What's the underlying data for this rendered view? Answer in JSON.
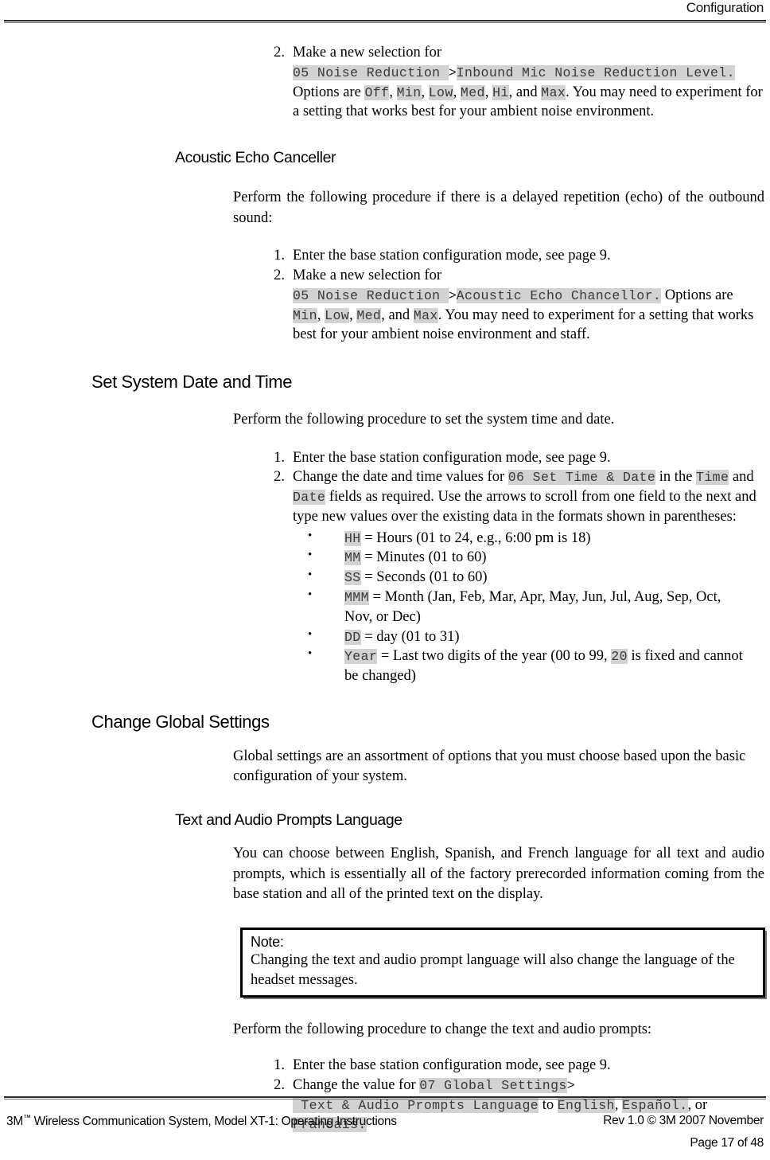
{
  "header": {
    "title": "Configuration"
  },
  "footer": {
    "left_prefix": "3M",
    "left_tm": "™",
    "left_rest": " Wireless Communication System, Model XT-1: Operating Instructions",
    "right": "Rev 1.0 © 3M 2007 November",
    "page": "Page 17 of 48"
  },
  "noise_reduction_step": {
    "num": "2.",
    "t1": "Make a new selection for ",
    "kw1": "05 Noise Reduction ",
    "gt1": ">",
    "kw2": "Inbound Mic Noise Reduction Level.",
    "t2": " Options are ",
    "opt1": "Off",
    "c1": ", ",
    "opt2": "Min",
    "c2": ", ",
    "opt3": "Low",
    "c3": ", ",
    "opt4": "Med",
    "c4": ", ",
    "opt5": "Hi",
    "t3": ", and ",
    "opt6": "Max",
    "t4": ".  You may need to experiment for a setting that works best for your ambient noise environment."
  },
  "acoustic_echo": {
    "heading": "Acoustic Echo Canceller",
    "intro": "Perform the following procedure if there is a delayed repetition (echo) of the outbound sound:",
    "step1_num": "1.",
    "step1": "Enter the base station configuration mode, see page 9.",
    "step2_num": "2.",
    "step2_t1": "Make a new selection for ",
    "step2_kw1": "05 Noise Reduction ",
    "step2_gt": ">",
    "step2_kw2": "Acoustic Echo Chancellor.",
    "step2_t2": "  Options are ",
    "step2_opt1": "Min",
    "step2_c1": ", ",
    "step2_opt2": "Low",
    "step2_c2": ", ",
    "step2_opt3": "Med",
    "step2_t3": ", and ",
    "step2_opt4": "Max",
    "step2_t4": ".  You may need to experiment for a setting that works best for your ambient noise environment and staff."
  },
  "set_date_time": {
    "heading": "Set System Date and Time",
    "intro": "Perform the following procedure to set the system time and date.",
    "step1_num": "1.",
    "step1": "Enter the base station configuration mode, see page 9.",
    "step2_num": "2.",
    "step2_t1": "Change the date and time values for  ",
    "step2_kw1": "06 Set Time & Date",
    "step2_t2": " in the ",
    "step2_kw2": "Time",
    "step2_t3": " and ",
    "step2_kw3": "Date",
    "step2_t4": " fields as required.  Use the arrows to scroll from one field to the next and type new values over the existing data in the formats shown in parentheses:",
    "formats": [
      {
        "bullet": "•",
        "code": "HH",
        "desc": " = Hours (01 to 24, e.g., 6:00 pm is 18)"
      },
      {
        "bullet": "•",
        "code": "MM",
        "desc": " = Minutes (01 to 60)"
      },
      {
        "bullet": "•",
        "code": "SS",
        "desc": " = Seconds (01 to 60)"
      },
      {
        "bullet": "•",
        "code": "MMM",
        "desc": " = Month (Jan, Feb, Mar, Apr, May, Jun, Jul, Aug, Sep, Oct, Nov, or Dec)"
      },
      {
        "bullet": "•",
        "code": "DD",
        "desc": " = day (01 to 31)"
      }
    ],
    "year_bullet": "•",
    "year_code": "Year",
    "year_t1": " = Last two digits of the year (00 to 99, ",
    "year_code2": "20",
    "year_t2": " is fixed and cannot be changed)"
  },
  "global_settings": {
    "heading": "Change Global Settings",
    "intro": "Global settings are an assortment of options that you must choose based upon the basic configuration of your system."
  },
  "text_audio": {
    "heading": "Text and Audio Prompts Language",
    "intro": "You can choose between English, Spanish, and French language for all text and audio prompts, which is essentially all of the factory prerecorded information coming from the base station and all of the printed text on the display.",
    "note_title": "Note:",
    "note_line1": "Changing the text and audio prompt language will also change the language of the",
    "note_line2": "headset messages.",
    "perform": "Perform the following procedure to change the text and audio prompts:",
    "step1_num": "1.",
    "step1": "Enter the base station configuration mode, see page 9.",
    "step2_num": "2.",
    "step2_t1": "Change the value for  ",
    "step2_kw1": "07 Global Settings",
    "step2_gt": ">",
    "step2_kw2": " Text & Audio Prompts Language",
    "step2_t2": " to ",
    "step2_opt1": "English",
    "step2_c1": ", ",
    "step2_opt2": "Español.",
    "step2_t3": ", or ",
    "step2_opt3": "Francais.",
    "step2_end": ""
  }
}
